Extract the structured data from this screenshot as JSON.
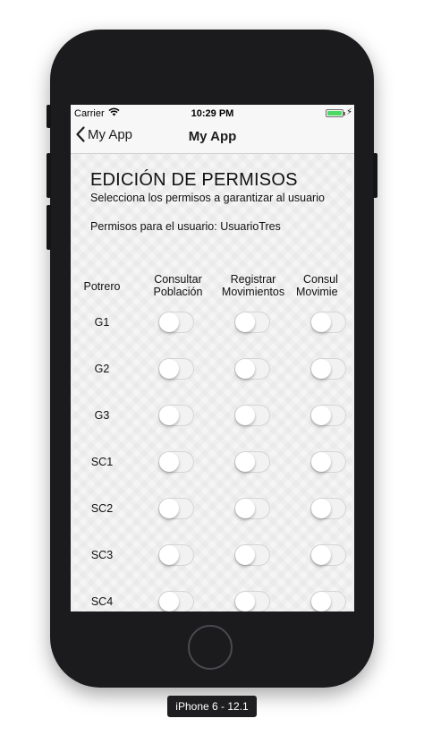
{
  "device": {
    "label": "iPhone 6 - 12.1"
  },
  "status_bar": {
    "carrier": "Carrier",
    "time": "10:29 PM"
  },
  "nav": {
    "back_label": "My App",
    "title": "My App"
  },
  "page": {
    "heading": "EDICIÓN DE PERMISOS",
    "subtitle": "Selecciona los permisos a garantizar al usuario",
    "user_line": "Permisos para el usuario: UsuarioTres"
  },
  "table": {
    "row_header": "Potrero",
    "columns": [
      {
        "line1": "Consultar",
        "line2": "Población"
      },
      {
        "line1": "Registrar",
        "line2": "Movimientos"
      },
      {
        "line1": "Consul",
        "line2": "Movimie"
      }
    ],
    "rows": [
      "G1",
      "G2",
      "G3",
      "SC1",
      "SC2",
      "SC3",
      "SC4"
    ]
  }
}
